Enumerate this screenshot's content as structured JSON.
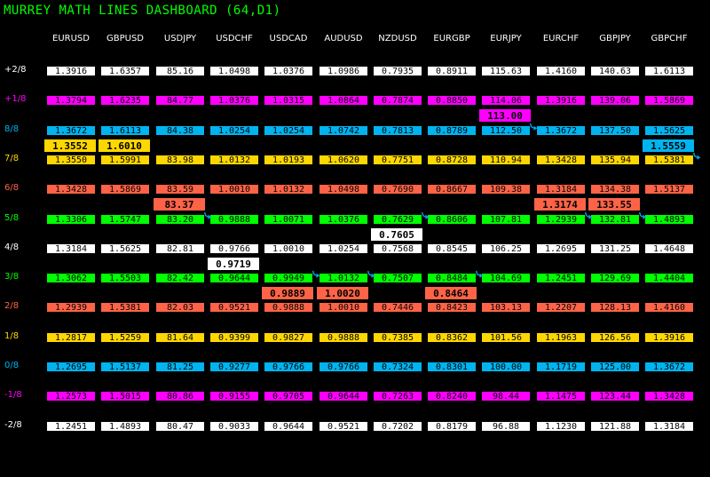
{
  "title": "MURREY MATH LINES DASHBOARD (64,D1)",
  "symbols": [
    "EURUSD",
    "GBPUSD",
    "USDJPY",
    "USDCHF",
    "USDCAD",
    "AUDUSD",
    "NZDUSD",
    "EURGBP",
    "EURJPY",
    "EURCHF",
    "GBPJPY",
    "GBPCHF"
  ],
  "levels": [
    {
      "label": "+2/8",
      "color": "#ffffff",
      "values": [
        "1.3916",
        "1.6357",
        "85.16",
        "1.0498",
        "1.0376",
        "1.0986",
        "0.7935",
        "0.8911",
        "115.63",
        "1.4160",
        "140.63",
        "1.6113"
      ]
    },
    {
      "label": "+1/8",
      "color": "#ff00ff",
      "values": [
        "1.3794",
        "1.6235",
        "84.77",
        "1.0376",
        "1.0315",
        "1.0864",
        "0.7874",
        "0.8850",
        "114.06",
        "1.3916",
        "139.06",
        "1.5869"
      ]
    },
    {
      "label": "8/8",
      "color": "#00b4f0",
      "values": [
        "1.3672",
        "1.6113",
        "84.38",
        "1.0254",
        "1.0254",
        "1.0742",
        "0.7813",
        "0.8789",
        "112.50",
        "1.3672",
        "137.50",
        "1.5625"
      ]
    },
    {
      "label": "7/8",
      "color": "#ffd700",
      "values": [
        "1.3550",
        "1.5991",
        "83.98",
        "1.0132",
        "1.0193",
        "1.0620",
        "0.7751",
        "0.8728",
        "110.94",
        "1.3428",
        "135.94",
        "1.5381"
      ]
    },
    {
      "label": "6/8",
      "color": "#ff6347",
      "values": [
        "1.3428",
        "1.5869",
        "83.59",
        "1.0010",
        "1.0132",
        "1.0498",
        "0.7690",
        "0.8667",
        "109.38",
        "1.3184",
        "134.38",
        "1.5137"
      ]
    },
    {
      "label": "5/8",
      "color": "#00ff00",
      "values": [
        "1.3306",
        "1.5747",
        "83.20",
        "0.9888",
        "1.0071",
        "1.0376",
        "0.7629",
        "0.8606",
        "107.81",
        "1.2939",
        "132.81",
        "1.4893"
      ]
    },
    {
      "label": "4/8",
      "color": "#ffffff",
      "values": [
        "1.3184",
        "1.5625",
        "82.81",
        "0.9766",
        "1.0010",
        "1.0254",
        "0.7568",
        "0.8545",
        "106.25",
        "1.2695",
        "131.25",
        "1.4648"
      ]
    },
    {
      "label": "3/8",
      "color": "#00ff00",
      "values": [
        "1.3062",
        "1.5503",
        "82.42",
        "0.9644",
        "0.9949",
        "1.0132",
        "0.7507",
        "0.8484",
        "104.69",
        "1.2451",
        "129.69",
        "1.4404"
      ]
    },
    {
      "label": "2/8",
      "color": "#ff6347",
      "values": [
        "1.2939",
        "1.5381",
        "82.03",
        "0.9521",
        "0.9888",
        "1.0010",
        "0.7446",
        "0.8423",
        "103.13",
        "1.2207",
        "128.13",
        "1.4160"
      ]
    },
    {
      "label": "1/8",
      "color": "#ffd700",
      "values": [
        "1.2817",
        "1.5259",
        "81.64",
        "0.9399",
        "0.9827",
        "0.9888",
        "0.7385",
        "0.8362",
        "101.56",
        "1.1963",
        "126.56",
        "1.3916"
      ]
    },
    {
      "label": "0/8",
      "color": "#00b4f0",
      "values": [
        "1.2695",
        "1.5137",
        "81.25",
        "0.9277",
        "0.9766",
        "0.9766",
        "0.7324",
        "0.8301",
        "100.00",
        "1.1719",
        "125.00",
        "1.3672"
      ]
    },
    {
      "label": "-1/8",
      "color": "#ff00ff",
      "values": [
        "1.2573",
        "1.5015",
        "80.86",
        "0.9155",
        "0.9705",
        "0.9644",
        "0.7263",
        "0.8240",
        "98.44",
        "1.1475",
        "123.44",
        "1.3428"
      ]
    },
    {
      "label": "-2/8",
      "color": "#ffffff",
      "values": [
        "1.2451",
        "1.4893",
        "80.47",
        "0.9033",
        "0.9644",
        "0.9521",
        "0.7202",
        "0.8179",
        "96.88",
        "1.1230",
        "121.88",
        "1.3184"
      ]
    }
  ],
  "current_prices": [
    {
      "symbol": "EURUSD",
      "value": "1.3552",
      "after_level": "8/8",
      "color": "#ffd700"
    },
    {
      "symbol": "GBPUSD",
      "value": "1.6010",
      "after_level": "8/8",
      "color": "#ffd700"
    },
    {
      "symbol": "USDJPY",
      "value": "83.37",
      "after_level": "6/8",
      "color": "#ff6347"
    },
    {
      "symbol": "USDCHF",
      "value": "0.9719",
      "after_level": "4/8",
      "color": "#ffffff"
    },
    {
      "symbol": "USDCAD",
      "value": "0.9889",
      "after_level": "3/8",
      "color": "#ff6347"
    },
    {
      "symbol": "AUDUSD",
      "value": "1.0020",
      "after_level": "3/8",
      "color": "#ff6347"
    },
    {
      "symbol": "NZDUSD",
      "value": "0.7605",
      "after_level": "5/8",
      "color": "#ffffff"
    },
    {
      "symbol": "EURGBP",
      "value": "0.8464",
      "after_level": "3/8",
      "color": "#ff6347"
    },
    {
      "symbol": "EURJPY",
      "value": "113.00",
      "after_level": "+1/8",
      "color": "#ff00ff"
    },
    {
      "symbol": "EURCHF",
      "value": "1.3174",
      "after_level": "6/8",
      "color": "#ff6347"
    },
    {
      "symbol": "GBPJPY",
      "value": "133.55",
      "after_level": "6/8",
      "color": "#ff6347"
    },
    {
      "symbol": "GBPCHF",
      "value": "1.5559",
      "after_level": "8/8",
      "color": "#00b4f0"
    }
  ],
  "signals": [
    {
      "symbol": "EURJPY",
      "level": "8/8",
      "icon": "curved-arrow-icon"
    },
    {
      "symbol": "GBPCHF",
      "level": "7/8",
      "icon": "curved-arrow-icon"
    },
    {
      "symbol": "USDJPY",
      "level": "5/8",
      "icon": "curved-arrow-icon"
    },
    {
      "symbol": "NZDUSD",
      "level": "5/8",
      "icon": "curved-arrow-icon"
    },
    {
      "symbol": "EURCHF",
      "level": "5/8",
      "icon": "curved-arrow-icon"
    },
    {
      "symbol": "GBPJPY",
      "level": "5/8",
      "icon": "curved-arrow-icon"
    },
    {
      "symbol": "USDCAD",
      "level": "3/8",
      "icon": "curved-arrow-icon"
    },
    {
      "symbol": "AUDUSD",
      "level": "3/8",
      "icon": "curved-arrow-icon"
    },
    {
      "symbol": "EURGBP",
      "level": "3/8",
      "icon": "curved-arrow-icon"
    }
  ],
  "arrow_color": "#00aaff"
}
